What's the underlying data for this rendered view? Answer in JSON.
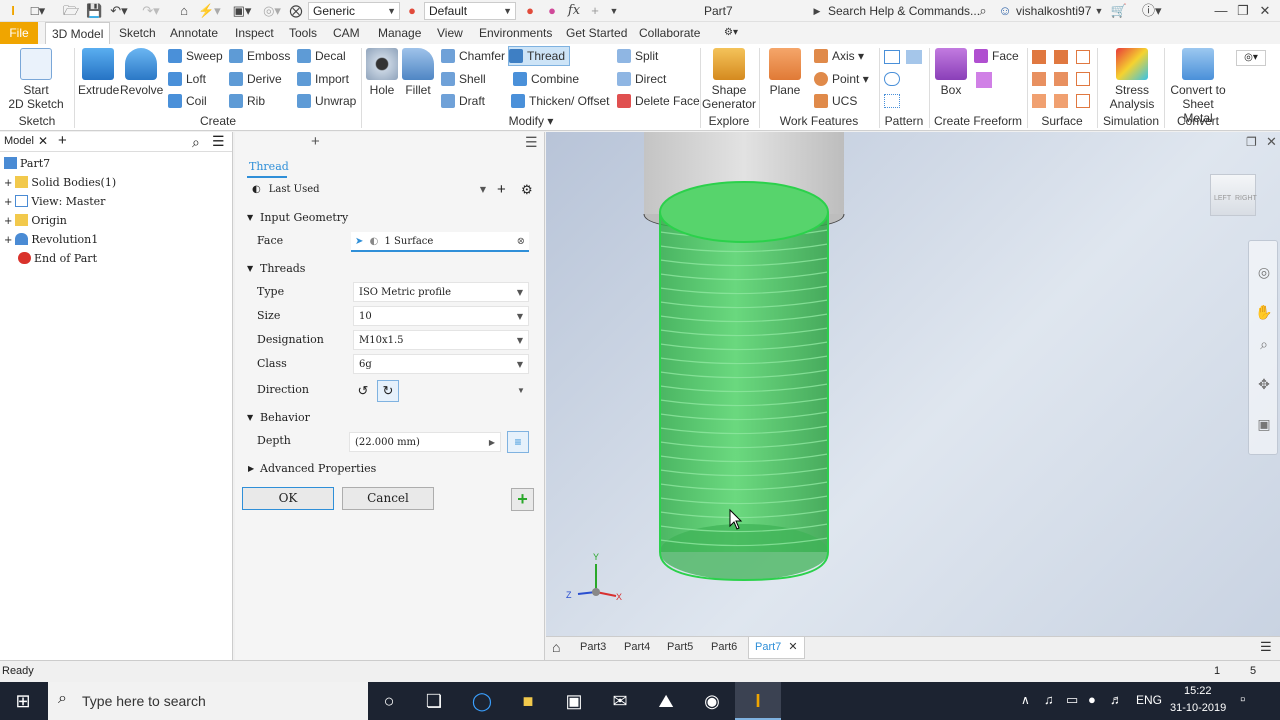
{
  "titlebar": {
    "appearance": "Generic",
    "material": "Default",
    "doc_title": "Part7",
    "search_placeholder": "Search Help & Commands...",
    "user": "vishalkoshti97"
  },
  "ribbon_tabs": [
    "File",
    "3D Model",
    "Sketch",
    "Annotate",
    "Inspect",
    "Tools",
    "CAM",
    "Manage",
    "View",
    "Environments",
    "Get Started",
    "Collaborate"
  ],
  "ribbon": {
    "start_sketch": "Start\n2D Sketch",
    "sketch_grp": "Sketch",
    "extrude": "Extrude",
    "revolve": "Revolve",
    "sweep": "Sweep",
    "loft": "Loft",
    "coil": "Coil",
    "emboss": "Emboss",
    "derive": "Derive",
    "rib": "Rib",
    "decal": "Decal",
    "import": "Import",
    "unwrap": "Unwrap",
    "create_grp": "Create",
    "hole": "Hole",
    "fillet": "Fillet",
    "chamfer": "Chamfer",
    "shell": "Shell",
    "draft": "Draft",
    "thread": "Thread",
    "combine": "Combine",
    "thicken": "Thicken/ Offset",
    "split": "Split",
    "direct": "Direct",
    "delete_face": "Delete Face",
    "modify_grp": "Modify",
    "shape_gen": "Shape\nGenerator",
    "explore_grp": "Explore",
    "plane": "Plane",
    "axis": "Axis",
    "point": "Point",
    "ucs": "UCS",
    "work_grp": "Work Features",
    "pattern_grp": "Pattern",
    "box": "Box",
    "face": "Face",
    "freeform_grp": "Create Freeform",
    "surface_grp": "Surface",
    "stress": "Stress\nAnalysis",
    "simulation_grp": "Simulation",
    "convert_sm": "Convert to\nSheet Metal",
    "convert_grp": "Convert"
  },
  "browser": {
    "tab": "Model",
    "items": [
      "Part7",
      "Solid Bodies(1)",
      "View: Master",
      "Origin",
      "Revolution1",
      "End of Part"
    ]
  },
  "thread_panel": {
    "title": "Thread",
    "preset": "Last Used",
    "input_geometry": "Input Geometry",
    "face_label": "Face",
    "face_value": "1 Surface",
    "threads_header": "Threads",
    "type_label": "Type",
    "type_value": "ISO Metric profile",
    "size_label": "Size",
    "size_value": "10",
    "designation_label": "Designation",
    "designation_value": "M10x1.5",
    "class_label": "Class",
    "class_value": "6g",
    "direction_label": "Direction",
    "behavior_header": "Behavior",
    "depth_label": "Depth",
    "depth_value": "(22.000 mm)",
    "advanced": "Advanced Properties",
    "ok": "OK",
    "cancel": "Cancel"
  },
  "viewcube": {
    "left": "LEFT",
    "right": "RIGHT"
  },
  "doc_tabs": [
    "Part3",
    "Part4",
    "Part5",
    "Part6",
    "Part7"
  ],
  "status": {
    "text": "Ready",
    "n1": "1",
    "n2": "5"
  },
  "taskbar": {
    "search_placeholder": "Type here to search",
    "lang": "ENG",
    "time": "15:22",
    "date": "31-10-2019"
  },
  "colors": {
    "accent": "#f0a500",
    "highlight": "#2f8fd8",
    "thread_green": "#3fcf5a",
    "taskbar": "#1c2331"
  }
}
